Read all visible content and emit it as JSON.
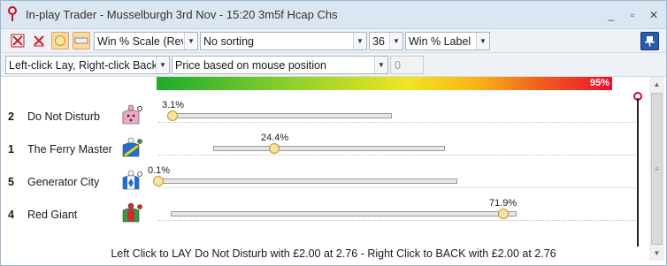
{
  "window": {
    "title": "In-play Trader - Musselburgh 3rd Nov - 15:20 3m5f Hcap Chs",
    "minimize_label": "_",
    "maximize_label": "▫",
    "close_label": "✕"
  },
  "toolbar1": {
    "scale_select": "Win % Scale (Rev",
    "sort_select": "No sorting",
    "size_select": "36",
    "label_select": "Win % Label"
  },
  "toolbar2": {
    "click_mode_select": "Left-click Lay, Right-click Back",
    "price_mode_select": "Price based on mouse position",
    "offset_value": "0"
  },
  "gradient_label": "95%",
  "runners": [
    {
      "number": "2",
      "name": "Do Not Disturb",
      "percent_label": "3.1%",
      "silk_color": "#f2a7c6"
    },
    {
      "number": "1",
      "name": "The Ferry Master",
      "percent_label": "24.4%",
      "silk_color": "#1f6fd1"
    },
    {
      "number": "5",
      "name": "Generator City",
      "percent_label": "0.1%",
      "silk_color": "#1f6fd1"
    },
    {
      "number": "4",
      "name": "Red Giant",
      "percent_label": "71.9%",
      "silk_color": "#d22b2b"
    }
  ],
  "status_text": "Left Click to LAY Do Not Disturb with £2.00 at 2.76 - Right Click to BACK with £2.00 at 2.76",
  "colors": {
    "accent": "#2a5aa8",
    "knob": "#f7e39a",
    "gradient_start": "#1daa2b",
    "gradient_end": "#e8112d"
  }
}
